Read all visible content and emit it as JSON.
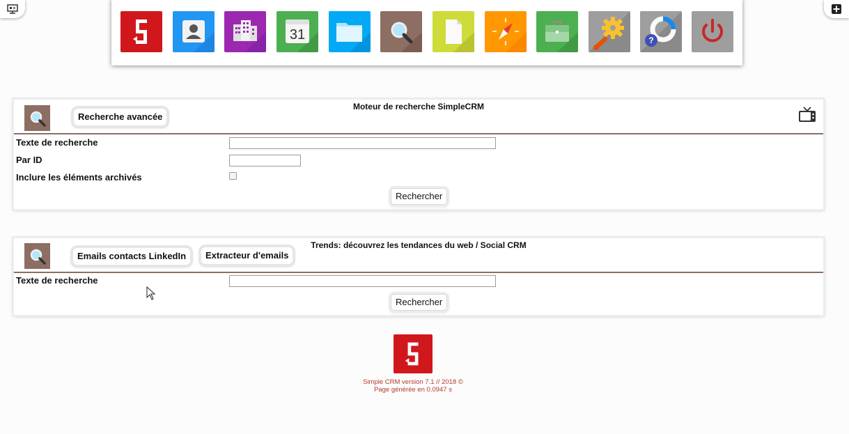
{
  "toolbar": {
    "apps": [
      {
        "name": "simplecrm-logo-icon",
        "color": "#d0181c"
      },
      {
        "name": "contacts-icon",
        "color": "#2196f3"
      },
      {
        "name": "companies-icon",
        "color": "#9c27b0"
      },
      {
        "name": "calendar-icon",
        "color": "#4caf50",
        "label": "31"
      },
      {
        "name": "folder-icon",
        "color": "#03a9f4"
      },
      {
        "name": "search-icon",
        "color": "#8d6e63"
      },
      {
        "name": "document-icon",
        "color": "#cddc39"
      },
      {
        "name": "compass-icon",
        "color": "#ff9800"
      },
      {
        "name": "briefcase-icon",
        "color": "#4caf50"
      },
      {
        "name": "settings-icon",
        "color": "#8a8a8a"
      },
      {
        "name": "help-icon",
        "color": "#8a8a8a"
      },
      {
        "name": "power-icon",
        "color": "#9e9e9e"
      }
    ]
  },
  "search_panel": {
    "title": "Moteur de recherche SimpleCRM",
    "advanced_label": "Recherche avancée",
    "fields": {
      "text_label": "Texte de recherche",
      "text_value": "",
      "id_label": "Par ID",
      "id_value": "",
      "archived_label": "Inclure les éléments archivés"
    },
    "submit_label": "Rechercher"
  },
  "trends_panel": {
    "title": "Trends: découvrez les tendances du web / Social CRM",
    "linkedin_label": "Emails contacts LinkedIn",
    "extractor_label": "Extracteur d'emails",
    "text_label": "Texte de recherche",
    "text_value": "",
    "submit_label": "Rechercher"
  },
  "footer": {
    "version": "Simple CRM version 7.1 // 2018 ©",
    "generated": "Page générée en 0.0947 s"
  },
  "colors": {
    "accent_brown": "#8d6e63",
    "brand_red": "#d0181c"
  }
}
